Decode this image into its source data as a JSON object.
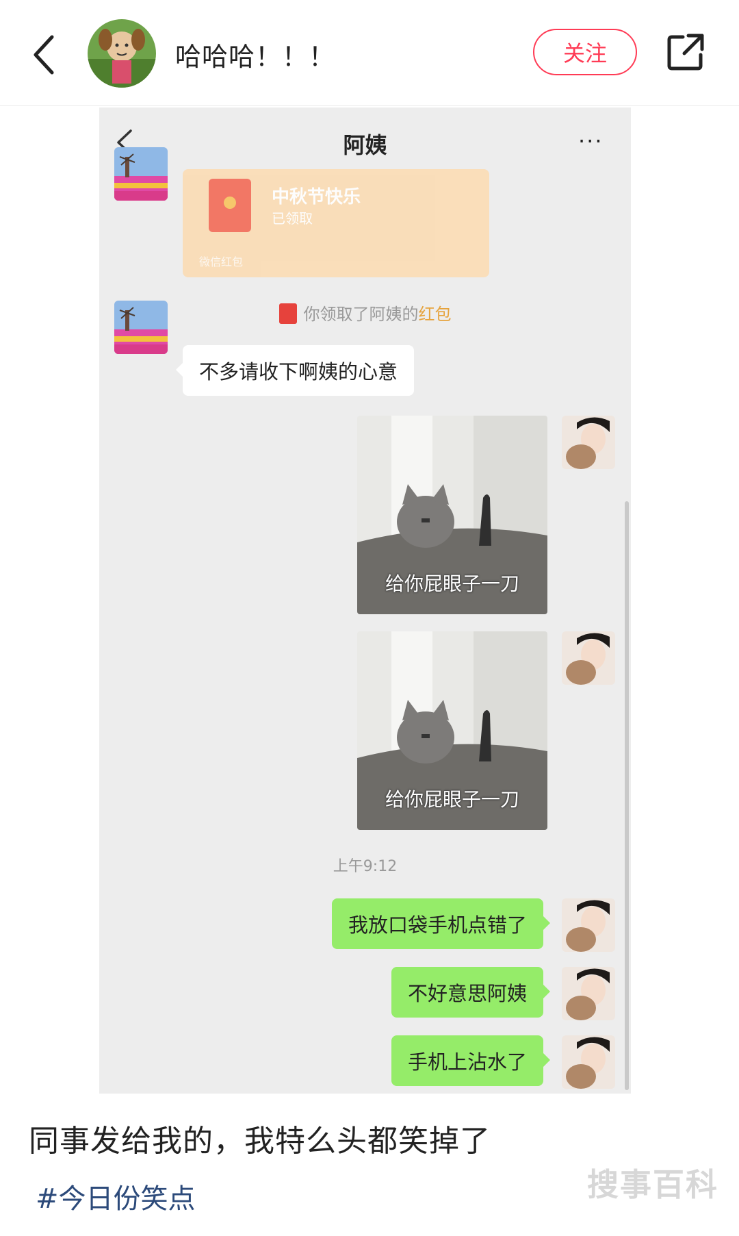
{
  "header": {
    "author_name": "哈哈哈！！！",
    "follow_label": "关注",
    "icons": [
      "chevron-left-icon",
      "share-icon"
    ]
  },
  "chat": {
    "title": "阿姨",
    "more": "···",
    "red_packet": {
      "title": "中秋节快乐",
      "status": "已领取",
      "footer": "微信红包"
    },
    "system_note": {
      "prefix": "你领取了阿姨的",
      "highlight": "红包"
    },
    "left_message": "不多请收下啊姨的心意",
    "stickers": [
      {
        "caption": "给你屁眼子一刀"
      },
      {
        "caption": "给你屁眼子一刀"
      }
    ],
    "time": "上午9:12",
    "right_messages": [
      "我放口袋手机点错了",
      "不好意思阿姨",
      "手机上沾水了"
    ]
  },
  "post": {
    "caption": "同事发给我的，我特么头都笑掉了",
    "hashtag": "#今日份笑点",
    "watermark": "搜事百科"
  },
  "colors": {
    "accent": "#ff3b55",
    "chat_bg": "#ededed",
    "bubble_green": "#95ec69",
    "hashtag": "#2c4a7a"
  }
}
